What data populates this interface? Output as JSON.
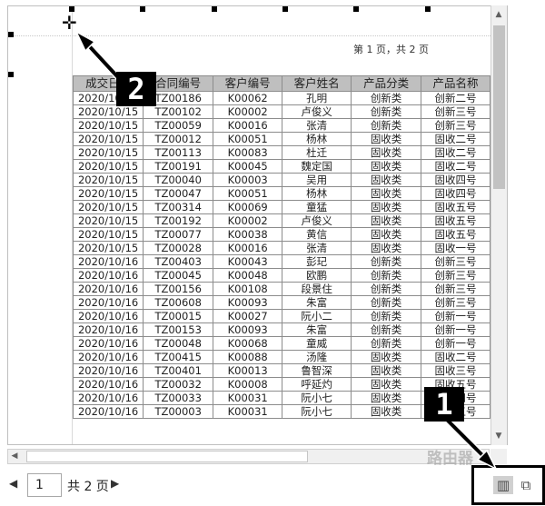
{
  "page_info": "第 1 页，共 2 页",
  "table": {
    "headers": [
      "成交日期",
      "合同编号",
      "客户编号",
      "客户姓名",
      "产品分类",
      "产品名称"
    ],
    "rows": [
      [
        "2020/10/15",
        "TZ00186",
        "K00062",
        "孔明",
        "创新类",
        "创新二号"
      ],
      [
        "2020/10/15",
        "TZ00102",
        "K00002",
        "卢俊义",
        "创新类",
        "创新三号"
      ],
      [
        "2020/10/15",
        "TZ00059",
        "K00016",
        "张清",
        "创新类",
        "创新三号"
      ],
      [
        "2020/10/15",
        "TZ00012",
        "K00051",
        "杨林",
        "固收类",
        "固收二号"
      ],
      [
        "2020/10/15",
        "TZ00113",
        "K00083",
        "杜迁",
        "固收类",
        "固收二号"
      ],
      [
        "2020/10/15",
        "TZ00191",
        "K00045",
        "魏定国",
        "固收类",
        "固收二号"
      ],
      [
        "2020/10/15",
        "TZ00040",
        "K00003",
        "吴用",
        "固收类",
        "固收四号"
      ],
      [
        "2020/10/15",
        "TZ00047",
        "K00051",
        "杨林",
        "固收类",
        "固收四号"
      ],
      [
        "2020/10/15",
        "TZ00314",
        "K00069",
        "童猛",
        "固收类",
        "固收五号"
      ],
      [
        "2020/10/15",
        "TZ00192",
        "K00002",
        "卢俊义",
        "固收类",
        "固收五号"
      ],
      [
        "2020/10/15",
        "TZ00077",
        "K00038",
        "黄信",
        "固收类",
        "固收五号"
      ],
      [
        "2020/10/15",
        "TZ00028",
        "K00016",
        "张清",
        "固收类",
        "固收一号"
      ],
      [
        "2020/10/16",
        "TZ00403",
        "K00043",
        "彭玘",
        "创新类",
        "创新三号"
      ],
      [
        "2020/10/16",
        "TZ00045",
        "K00048",
        "欧鹏",
        "创新类",
        "创新三号"
      ],
      [
        "2020/10/16",
        "TZ00156",
        "K00108",
        "段景住",
        "创新类",
        "创新三号"
      ],
      [
        "2020/10/16",
        "TZ00608",
        "K00093",
        "朱富",
        "创新类",
        "创新三号"
      ],
      [
        "2020/10/16",
        "TZ00015",
        "K00027",
        "阮小二",
        "创新类",
        "创新一号"
      ],
      [
        "2020/10/16",
        "TZ00153",
        "K00093",
        "朱富",
        "创新类",
        "创新一号"
      ],
      [
        "2020/10/16",
        "TZ00048",
        "K00068",
        "童威",
        "创新类",
        "创新一号"
      ],
      [
        "2020/10/16",
        "TZ00415",
        "K00088",
        "汤隆",
        "固收类",
        "固收二号"
      ],
      [
        "2020/10/16",
        "TZ00401",
        "K00013",
        "鲁智深",
        "固收类",
        "固收三号"
      ],
      [
        "2020/10/16",
        "TZ00032",
        "K00008",
        "呼延灼",
        "固收类",
        "固收五号"
      ],
      [
        "2020/10/16",
        "TZ00033",
        "K00031",
        "阮小七",
        "固收类",
        "固收四号"
      ],
      [
        "2020/10/16",
        "TZ00003",
        "K00031",
        "阮小七",
        "固收类",
        "固收五号"
      ]
    ]
  },
  "pager": {
    "current_page": "1",
    "total_label": "共 2 页"
  },
  "callouts": {
    "one": "1",
    "two": "2"
  },
  "watermark": "路由器",
  "icons": {
    "move": "move-cursor-icon",
    "prev": "triangle-left-icon",
    "next": "triangle-right-icon",
    "scroll_up": "scroll-up-icon",
    "scroll_down": "scroll-down-icon",
    "scroll_left": "scroll-left-icon",
    "view_single": "single-page-view-icon",
    "view_multi": "multi-page-view-icon"
  }
}
